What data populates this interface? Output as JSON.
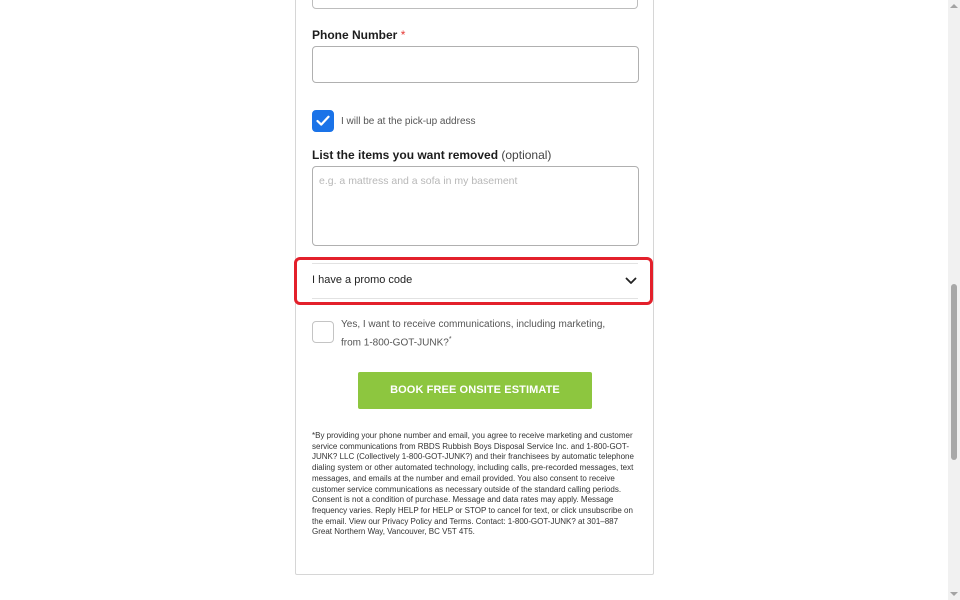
{
  "form": {
    "phone": {
      "label": "Phone Number",
      "required_mark": "*",
      "value": ""
    },
    "pickup_checkbox": {
      "checked": true,
      "label": "I will be at the pick-up address"
    },
    "items": {
      "label": "List the items you want removed",
      "optional_label": "(optional)",
      "placeholder": "e.g. a mattress and a sofa in my basement"
    },
    "promo": {
      "label": "I have a promo code",
      "icon": "chevron-down-icon"
    },
    "marketing_checkbox": {
      "checked": false,
      "label_line1": "Yes, I want to receive communications, including marketing,",
      "label_line2": "from 1-800-GOT-JUNK?",
      "footnote_mark": "*"
    },
    "submit_label": "BOOK FREE ONSITE ESTIMATE",
    "disclaimer": "*By providing your phone number and email, you agree to receive marketing and customer service communications from RBDS Rubbish Boys Disposal Service Inc. and 1-800-GOT-JUNK? LLC (Collectively 1-800-GOT-JUNK?) and their franchisees by automatic telephone dialing system or other automated technology, including calls, pre-recorded messages, text messages, and emails at the number and email provided. You also consent to receive customer service communications as necessary outside of the standard calling periods. Consent is not a condition of purchase. Message and data rates may apply. Message frequency varies. Reply HELP for HELP or STOP to cancel for text, or click unsubscribe on the email. View our Privacy Policy and Terms. Contact: 1-800-GOT-JUNK? at 301–887 Great Northern Way, Vancouver, BC V5T 4T5."
  },
  "colors": {
    "accent_blue": "#1a73e8",
    "cta_green": "#8dc63f",
    "required_red": "#e53935",
    "highlight_red": "#e3202b"
  }
}
